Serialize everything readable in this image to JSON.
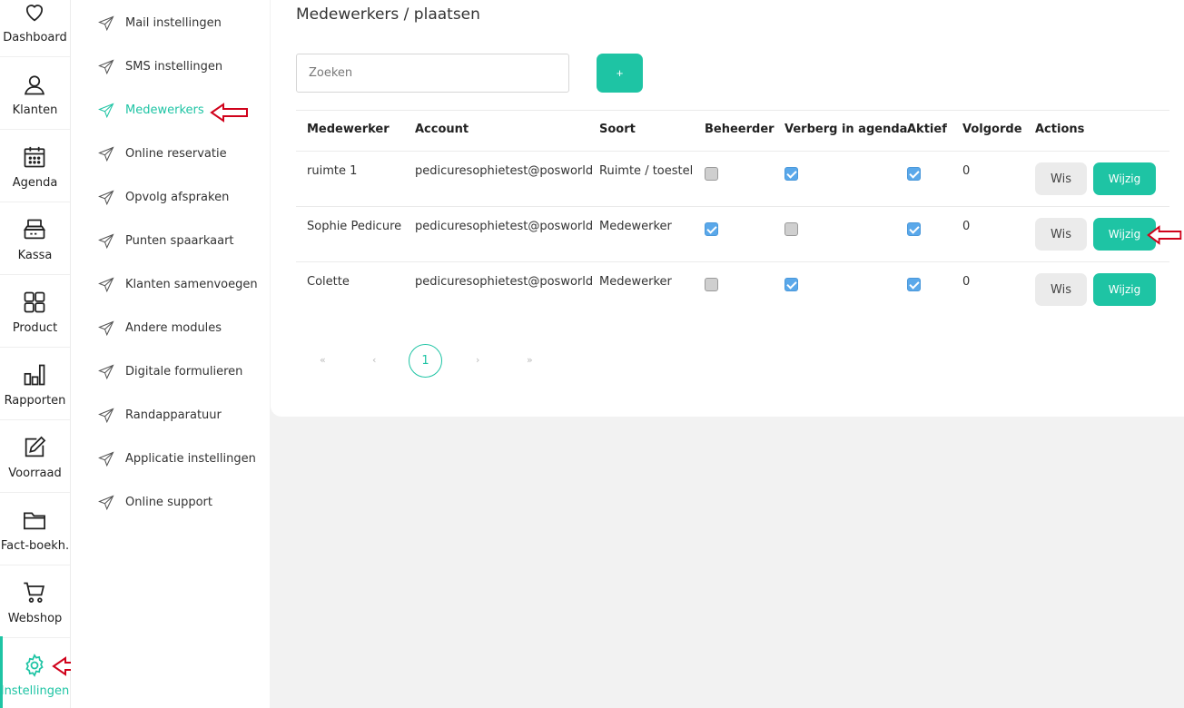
{
  "rail": {
    "items": [
      {
        "label": "Dashboard",
        "icon": "heart-icon"
      },
      {
        "label": "Klanten",
        "icon": "user-icon"
      },
      {
        "label": "Agenda",
        "icon": "calendar-icon"
      },
      {
        "label": "Kassa",
        "icon": "cash-register-icon"
      },
      {
        "label": "Product",
        "icon": "grid-icon"
      },
      {
        "label": "Rapporten",
        "icon": "bar-chart-icon"
      },
      {
        "label": "Voorraad",
        "icon": "edit-icon"
      },
      {
        "label": "Fact-boekh.",
        "icon": "folder-icon"
      },
      {
        "label": "Webshop",
        "icon": "cart-icon"
      },
      {
        "label": "Instellingen",
        "icon": "gear-icon",
        "active": true
      }
    ]
  },
  "submenu": {
    "items": [
      {
        "label": "Mail instellingen"
      },
      {
        "label": "SMS instellingen"
      },
      {
        "label": "Medewerkers",
        "active": true
      },
      {
        "label": "Online reservatie"
      },
      {
        "label": "Opvolg afspraken"
      },
      {
        "label": "Punten spaarkaart"
      },
      {
        "label": "Klanten samenvoegen"
      },
      {
        "label": "Andere modules"
      },
      {
        "label": "Digitale formulieren"
      },
      {
        "label": "Randapparatuur"
      },
      {
        "label": "Applicatie instellingen"
      },
      {
        "label": "Online support"
      }
    ]
  },
  "main": {
    "title": "Medewerkers / plaatsen",
    "search_placeholder": "Zoeken",
    "add_label": "+",
    "columns": [
      "Medewerker",
      "Account",
      "Soort",
      "Beheerder",
      "Verberg in agenda",
      "Aktief",
      "Volgorde",
      "Actions"
    ],
    "rows": [
      {
        "name": "ruimte 1",
        "account": "pedicuresophietest@posworld",
        "soort": "Ruimte / toestel",
        "beheerder": false,
        "verberg": true,
        "aktief": true,
        "volgorde": "0"
      },
      {
        "name": "Sophie Pedicure",
        "account": "pedicuresophietest@posworld",
        "soort": "Medewerker",
        "beheerder": true,
        "verberg": false,
        "aktief": true,
        "volgorde": "0"
      },
      {
        "name": "Colette",
        "account": "pedicuresophietest@posworld",
        "soort": "Medewerker",
        "beheerder": false,
        "verberg": true,
        "aktief": true,
        "volgorde": "0"
      }
    ],
    "wis_label": "Wis",
    "wijzig_label": "Wijzig",
    "pagination": {
      "first": "«",
      "prev": "‹",
      "current": "1",
      "next": "›",
      "last": "»"
    }
  },
  "colors": {
    "accent": "#1ec4a4",
    "checkbox_on": "#5aa8ea",
    "annotation_arrow": "#d0021b"
  }
}
